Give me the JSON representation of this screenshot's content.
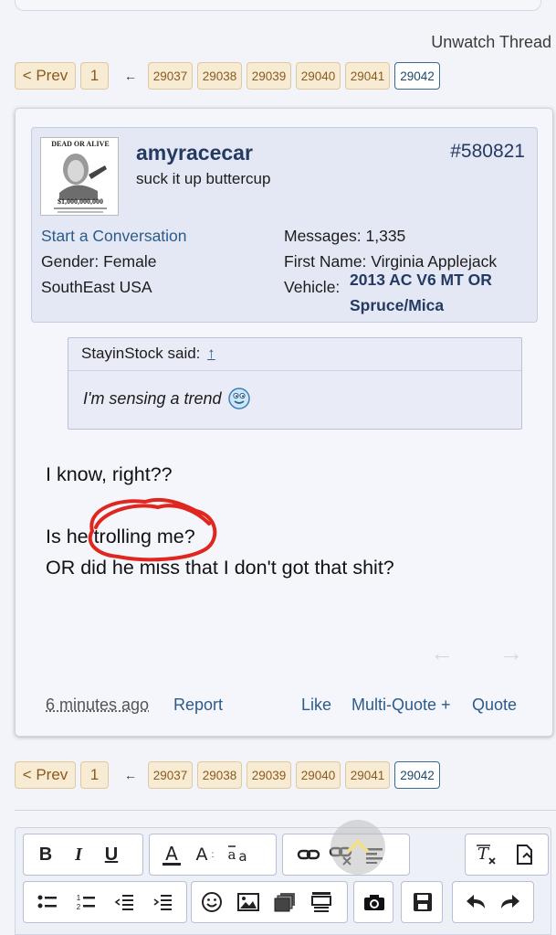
{
  "thread": {
    "unwatch_label": "Unwatch Thread"
  },
  "pager": {
    "prev_label": "< Prev",
    "first": "1",
    "ellipsis": "←",
    "pages": [
      "29037",
      "29038",
      "29039",
      "29040",
      "29041"
    ],
    "current": "29042"
  },
  "post": {
    "username": "amyracecar",
    "user_title": "suck it up buttercup",
    "post_number": "#580821",
    "start_conversation": "Start a Conversation",
    "gender_label": "Gender:",
    "gender_value": "Female",
    "location": "SouthEast USA",
    "messages_label": "Messages:",
    "messages_value": "1,335",
    "first_name_label": "First Name:",
    "first_name_value": "Virginia Applejack",
    "vehicle_label": "Vehicle:",
    "vehicle_value": "2013 AC V6 MT OR Spruce/Mica",
    "avatar_text_top": "DEAD OR ALIVE",
    "avatar_text_bottom": "$1,000,000,000",
    "quote": {
      "author": "StayinStock said:",
      "arrow": "↑",
      "text": "I'm sensing a trend"
    },
    "message_lines": [
      "I know, right??",
      "Is he trolling me?",
      "OR did he miss that I don't got that shit?"
    ],
    "time": "6 minutes ago",
    "report": "Report",
    "like": "Like",
    "multi_quote": "Multi-Quote +",
    "quote_btn": "Quote"
  },
  "toolbar": {
    "row1": [
      "B",
      "I",
      "U"
    ],
    "colors": {
      "accent": "#2c5b8a",
      "pager_bg": "#f7ecd3",
      "pager_border": "#dcc9a0"
    }
  }
}
